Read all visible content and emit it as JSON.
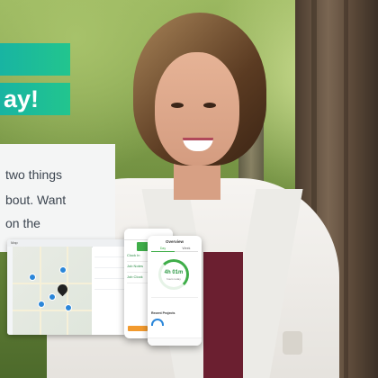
{
  "banner": {
    "line1": "",
    "line2": "ay!"
  },
  "text_card": {
    "lines": [
      "two things",
      "bout. Want",
      "on the"
    ]
  },
  "map_app": {
    "title": "Map"
  },
  "phone_checkin": {
    "row1": "Clock In",
    "row2": "Job Notes",
    "row3": "Job Clock"
  },
  "phone_overview": {
    "title": "Overview",
    "tabs": [
      "Day",
      "Week"
    ],
    "ring_value": "4h 01m",
    "ring_caption": "hours today",
    "recent_heading": "Recent Projects"
  },
  "colors": {
    "brand_teal": "#18b4a2",
    "brand_green": "#22c58e",
    "app_green": "#3fae49",
    "pin_blue": "#2b86d9"
  }
}
